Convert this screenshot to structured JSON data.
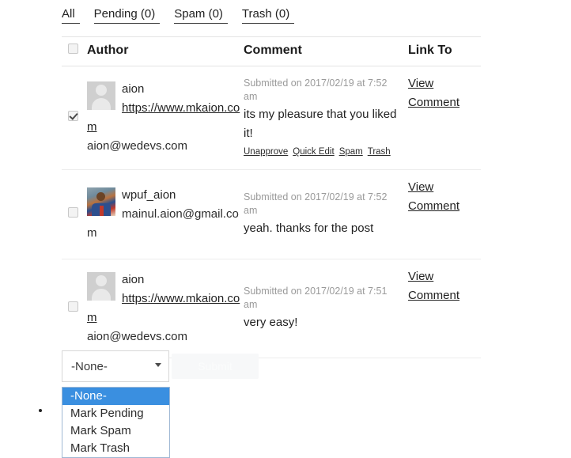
{
  "tabs": [
    {
      "label": "All"
    },
    {
      "label": "Pending (0)"
    },
    {
      "label": "Spam (0)"
    },
    {
      "label": "Trash (0)"
    }
  ],
  "table": {
    "columns": {
      "checkbox": "",
      "author": "Author",
      "comment": "Comment",
      "link_to": "Link To"
    },
    "select_all_checked": false,
    "rows": [
      {
        "checked": true,
        "avatar": "default-avatar-icon",
        "author_name": "aion",
        "author_url": "https://www.mkaion.com",
        "author_email": "aion@wedevs.com",
        "submitted": "Submitted on 2017/02/19 at 7:52 am",
        "comment_text": "its my pleasure that you liked it!",
        "actions": [
          "Unapprove",
          "Quick Edit",
          "Spam",
          "Trash"
        ],
        "link_to": "View Comment"
      },
      {
        "checked": false,
        "avatar": "photo-avatar-icon",
        "author_name": "wpuf_aion",
        "author_url": "",
        "author_email": "mainul.aion@gmail.com",
        "submitted": "Submitted on 2017/02/19 at 7:52 am",
        "comment_text": "yeah. thanks for the post",
        "actions": [],
        "link_to": "View Comment"
      },
      {
        "checked": false,
        "avatar": "default-avatar-icon",
        "author_name": "aion",
        "author_url": "https://www.mkaion.com",
        "author_email": "aion@wedevs.com",
        "submitted": "Submitted on 2017/02/19 at 7:51 am",
        "comment_text": "very easy!",
        "actions": [],
        "link_to": "View Comment"
      }
    ]
  },
  "bulk_actions": {
    "selected_value": "-None-",
    "submit_label": "Submit",
    "options": [
      "-None-",
      "Mark Pending",
      "Mark Spam",
      "Mark Trash"
    ],
    "open": true,
    "highlight_color": "#3a8fe0"
  }
}
